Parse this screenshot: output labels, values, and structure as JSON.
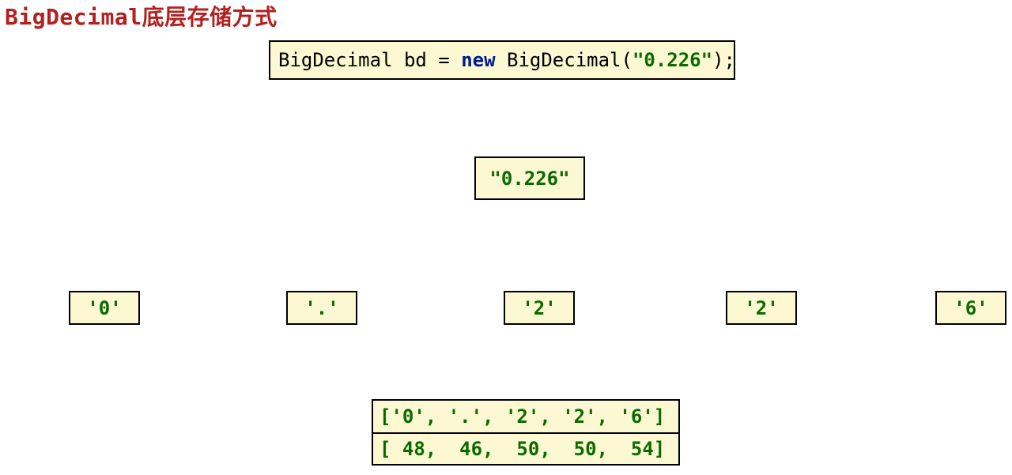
{
  "title": "BigDecimal底层存储方式",
  "code": {
    "pre": "BigDecimal bd = ",
    "kw": "new",
    "mid": " BigDecimal(",
    "str": "\"0.226\"",
    "post": ");"
  },
  "stringLiteral": "\"0.226\"",
  "chars": [
    "'0'",
    "'.'",
    "'2'",
    "'2'",
    "'6'"
  ],
  "arrays": {
    "charRow": "['0', '.', '2', '2', '6']",
    "intRow": "[ 48,  46,  50,  50,  54]"
  }
}
